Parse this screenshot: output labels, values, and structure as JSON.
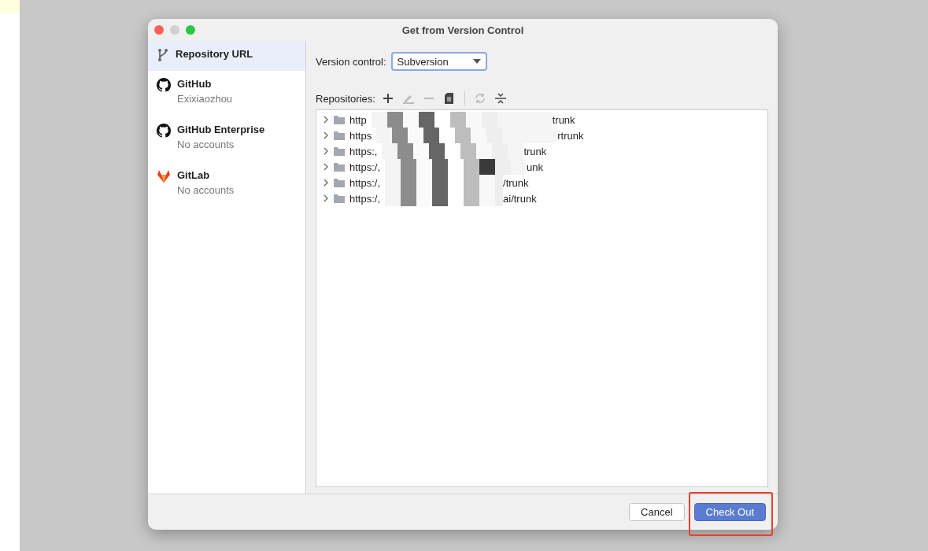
{
  "window": {
    "title": "Get from Version Control"
  },
  "sidebar": {
    "items": [
      {
        "kind": "branch",
        "label": "Repository URL",
        "selected": true
      },
      {
        "kind": "github",
        "label": "GitHub",
        "subtitle": "Exixiaozhou",
        "selected": false
      },
      {
        "kind": "github",
        "label": "GitHub Enterprise",
        "subtitle": "No accounts",
        "selected": false
      },
      {
        "kind": "gitlab",
        "label": "GitLab",
        "subtitle": "No accounts",
        "selected": false
      }
    ]
  },
  "version_control": {
    "label": "Version control:",
    "value": "Subversion"
  },
  "repositories": {
    "label": "Repositories:",
    "toolbar": [
      {
        "kind": "add",
        "disabled": false
      },
      {
        "kind": "edit",
        "disabled": true
      },
      {
        "kind": "remove",
        "disabled": true
      },
      {
        "kind": "copy",
        "disabled": false
      },
      {
        "kind": "separator"
      },
      {
        "kind": "refresh",
        "disabled": true
      },
      {
        "kind": "collapse",
        "disabled": false
      }
    ],
    "rows": [
      {
        "prefix": "http",
        "suffix": "trunk",
        "expanded": false
      },
      {
        "prefix": "https",
        "suffix": "rtrunk",
        "expanded": false
      },
      {
        "prefix": "https:,",
        "suffix": "trunk",
        "expanded": false
      },
      {
        "prefix": "https:/,",
        "suffix": "unk",
        "expanded": false
      },
      {
        "prefix": "https:/,",
        "suffix": "/trunk",
        "expanded": false
      },
      {
        "prefix": "https:/,",
        "suffix": "ai/trunk",
        "expanded": false
      }
    ]
  },
  "buttons": [
    {
      "label": "Cancel",
      "primary": false
    },
    {
      "label": "Check Out",
      "primary": true,
      "highlighted": true
    }
  ]
}
